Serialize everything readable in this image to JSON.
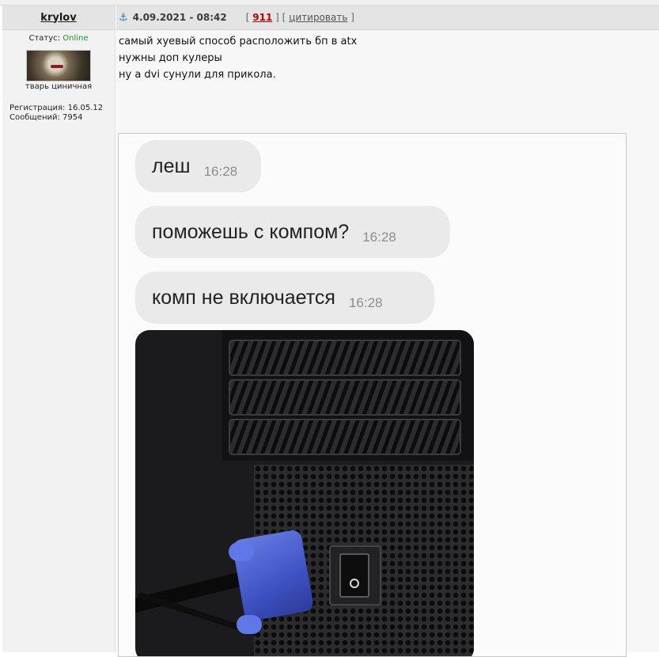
{
  "user": {
    "name": "krylov",
    "status_label": "Статус:",
    "status_value": "Online",
    "title": "тварь циничная",
    "registration": "Регистрация: 16.05.12",
    "posts": "Сообщений: 7954"
  },
  "post": {
    "date": "4.09.2021 - 08:42",
    "number": "911",
    "quote_label": "цитировать",
    "bracket_open": "[",
    "bracket_mid": "] [",
    "bracket_close": "]",
    "lines": [
      "самый хуевый способ расположить бп в atx",
      "нужны доп кулеры",
      "ну а dvi сунули для прикола."
    ]
  },
  "chat": {
    "messages": [
      {
        "text": "леш",
        "time": "16:28"
      },
      {
        "text": "поможешь с компом?",
        "time": "16:28"
      },
      {
        "text": "комп не включается",
        "time": "16:28"
      }
    ]
  },
  "colors": {
    "online": "#1a9a1a",
    "post_number": "#c00000",
    "anchor": "#2a7ab8"
  }
}
